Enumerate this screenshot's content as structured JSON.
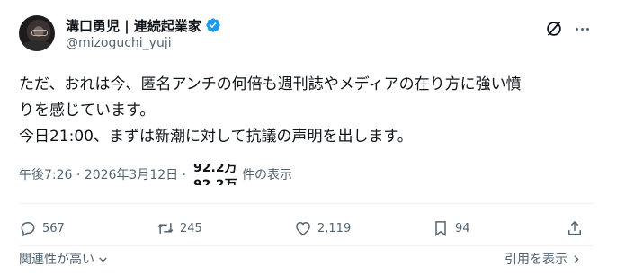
{
  "author": {
    "display_name": "溝口勇児 | 連続起業家",
    "handle": "@mizoguchi_yuji",
    "verified_color": "#1d9bf0"
  },
  "tweet": {
    "lines": [
      "ただ、おれは今、匿名アンチの何倍も週刊誌やメディアの在り方に強い憤",
      "りを感じています。",
      "今日21:00、まずは新潮に対して抗議の声明を出します。"
    ]
  },
  "meta": {
    "timestamp": "午後7:26 · 2026年3月12日 ·",
    "views_line1": "92.2万",
    "views_line2": "92.2万",
    "views_suffix": "件の表示"
  },
  "actions": {
    "replies": "567",
    "reposts": "245",
    "likes": "2,119",
    "bookmarks": "94"
  },
  "footer": {
    "sort_label": "関連性が高い",
    "quote_label": "引用を表示"
  },
  "icons": [
    "verified-badge-icon",
    "grok-icon",
    "more-icon",
    "reply-icon",
    "repost-icon",
    "like-icon",
    "bookmark-icon",
    "share-icon",
    "chevron-down-icon",
    "chevron-right-icon"
  ],
  "colors": {
    "text": "#0f1419",
    "secondary": "#536471",
    "accent": "#1d9bf0"
  }
}
